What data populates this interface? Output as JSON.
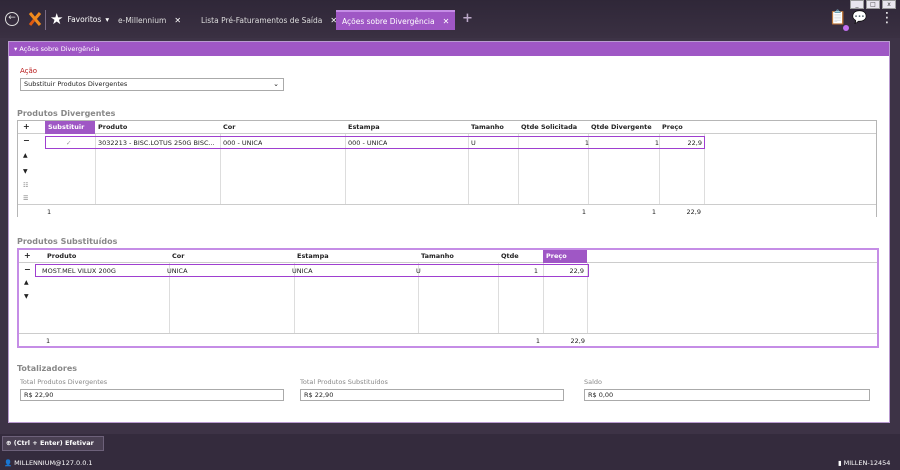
{
  "window": {
    "controls": [
      "_",
      "□",
      "x"
    ]
  },
  "titlebar": {
    "favorites_label": "Favoritos",
    "tabs": [
      {
        "label": "e-Millennium",
        "close": "✕"
      },
      {
        "label": "Lista Pré-Faturamentos de Saída",
        "close": "✕"
      },
      {
        "label": "Ações sobre Divergência",
        "close": "✕"
      }
    ],
    "add_tab": "+"
  },
  "panel": {
    "title": "▾ Ações sobre Divergência",
    "acao_label": "Ação",
    "acao_value": "Substituir Produtos Divergentes",
    "divergentes": {
      "section": "Produtos Divergentes",
      "headers": [
        "Substituir",
        "Produto",
        "Cor",
        "Estampa",
        "Tamanho",
        "Qtde Solicitada",
        "Qtde Divergente",
        "Preço"
      ],
      "row": {
        "check": "✓",
        "produto": "3032213 - BISC.LOTUS 250G BISC...",
        "cor": "000 - UNICA",
        "estampa": "000 - UNICA",
        "tamanho": "U",
        "qtde_sol": "1",
        "qtde_div": "1",
        "preco": "22,9"
      },
      "footer": {
        "count": "1",
        "qtde_sol": "1",
        "qtde_div": "1",
        "preco": "22,9"
      }
    },
    "substituidos": {
      "section": "Produtos Substituídos",
      "headers": [
        "Produto",
        "Cor",
        "Estampa",
        "Tamanho",
        "Qtde",
        "Preço"
      ],
      "row": {
        "produto": "MOST.MEL VILUX 200G",
        "cor": "UNICA",
        "estampa": "UNICA",
        "tamanho": "U",
        "qtde": "1",
        "preco": "22,9"
      },
      "footer": {
        "count": "1",
        "qtde": "1",
        "preco": "22,9"
      }
    },
    "totais": {
      "section": "Totalizadores",
      "div_label": "Total Produtos Divergentes",
      "div_value": "R$ 22,90",
      "sub_label": "Total Produtos Substituídos",
      "sub_value": "R$ 22,90",
      "saldo_label": "Saldo",
      "saldo_value": "R$ 0,00"
    }
  },
  "bottom": {
    "efetivar": "(Ctrl + Enter) Efetivar",
    "user": "MILLENNIUM@127.0.0.1",
    "server": "MILLEN-12454"
  }
}
